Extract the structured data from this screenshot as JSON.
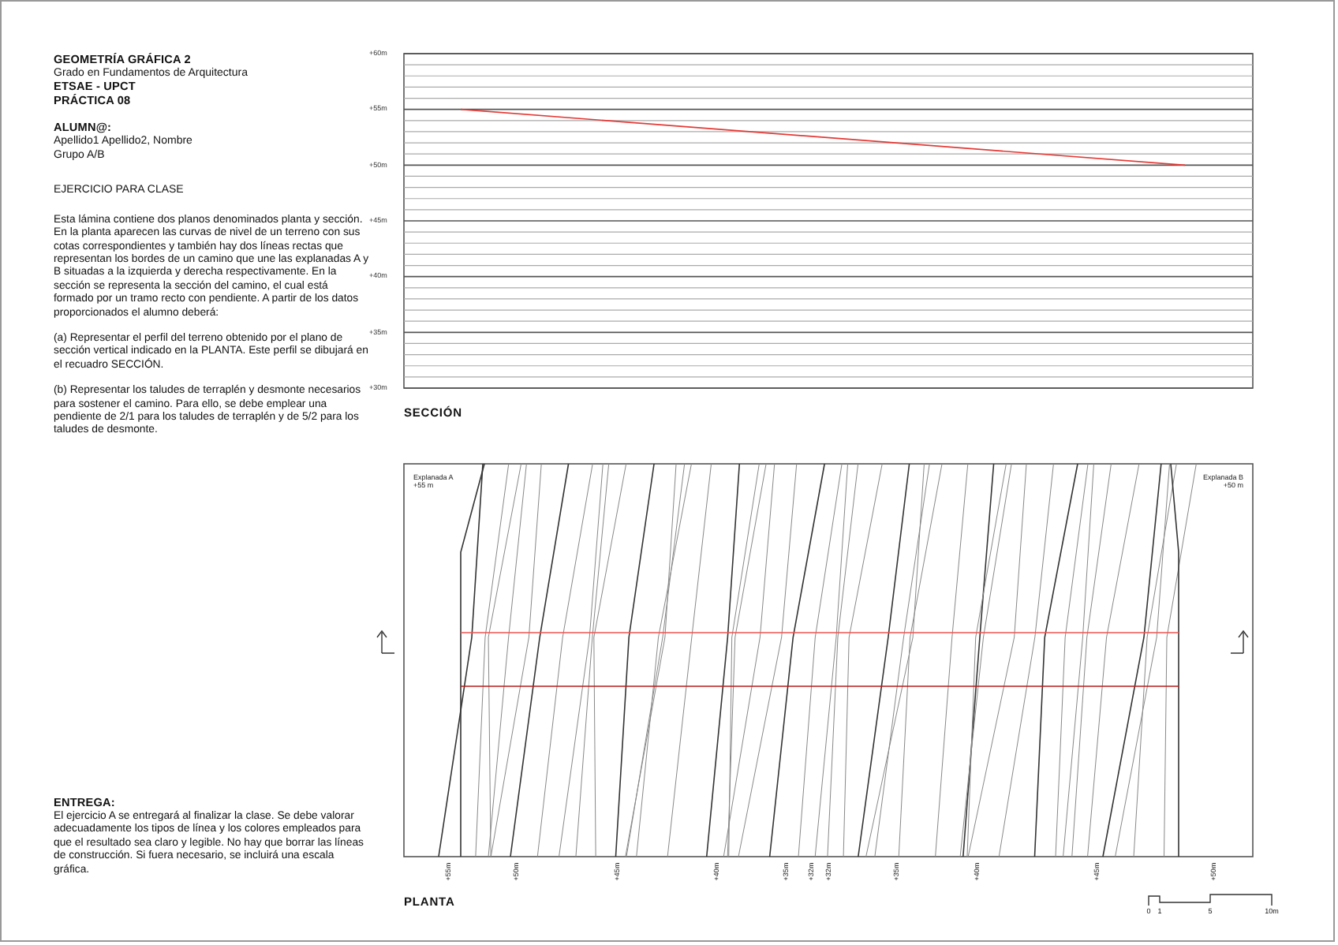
{
  "header": {
    "lines": [
      "GEOMETRÍA GRÁFICA 2",
      "Grado en Fundamentos de Arquitectura",
      "ETSAE - UPCT",
      "PRÁCTICA 08"
    ]
  },
  "student": {
    "heading": "ALUMN@:",
    "name": "Apellido1 Apellido2, Nombre",
    "group": "Grupo A/B"
  },
  "exercise": {
    "title": "EJERCICIO PARA CLASE",
    "paragraphs": [
      "Esta lámina contiene dos planos denominados planta y sección. En la planta aparecen las curvas de nivel de un terreno con sus cotas correspondientes y también hay dos líneas rectas que representan los bordes de un camino que une las explanadas A y B situadas a la izquierda y derecha respectivamente. En la sección se representa la sección del camino, el cual está formado por un tramo recto con pendiente. A partir de los datos proporcionados el alumno deberá:",
      "(a) Representar el perfil del terreno obtenido por el plano de sección vertical indicado en la PLANTA. Este perfil se dibujará en el recuadro SECCIÓN.",
      "(b) Representar los taludes de terraplén y desmonte necesarios para sostener el camino. Para ello, se debe emplear una pendiente de 2/1 para los taludes de terraplén y de 5/2 para los taludes de desmonte."
    ]
  },
  "delivery": {
    "title": "ENTREGA:",
    "text": "El ejercicio A se entregará al finalizar la clase. Se debe valorar adecuadamente los tipos de línea y los colores empleados para que el resultado sea claro y legible. No hay que borrar las líneas de construcción. Si fuera necesario, se incluirá una escala gráfica."
  },
  "section": {
    "elevation_labels": [
      "+60m",
      "+55m",
      "+50m",
      "+45m",
      "+40m",
      "+35m",
      "+30m"
    ],
    "caption": "SECCIÓN"
  },
  "plan": {
    "platform_a": {
      "name": "Explanada A",
      "elevation": "+55 m"
    },
    "platform_b": {
      "name": "Explanada B",
      "elevation": "+50 m"
    },
    "contour_labels": [
      "+55m",
      "+50m",
      "+45m",
      "+40m",
      "+35m",
      "+32m",
      "+32m",
      "+35m",
      "+40m",
      "+45m",
      "+50m"
    ],
    "caption": "PLANTA"
  },
  "scale_bar": {
    "labels": [
      "0",
      "1",
      "5",
      "10m"
    ]
  }
}
